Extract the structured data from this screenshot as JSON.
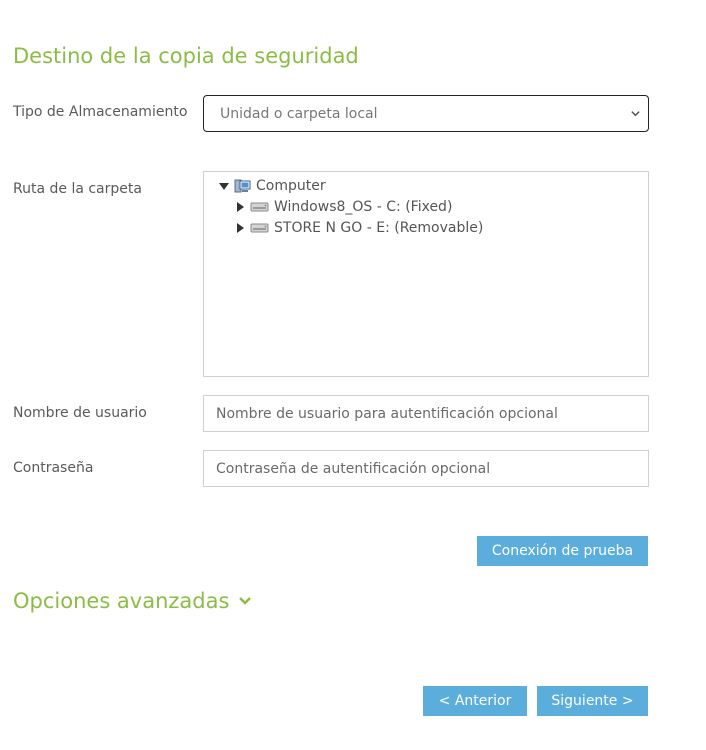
{
  "page": {
    "title": "Destino de la copia de seguridad"
  },
  "storage": {
    "label": "Tipo de Almacenamiento",
    "selected": "Unidad o carpeta local",
    "icon": "chevron-down-icon"
  },
  "folder": {
    "label": "Ruta de la carpeta",
    "tree": {
      "root": {
        "label": "Computer",
        "expanded": true,
        "icon": "computer-icon"
      },
      "children": [
        {
          "label": "Windows8_OS - C: (Fixed)",
          "expanded": false,
          "icon": "drive-icon"
        },
        {
          "label": "STORE N GO - E: (Removable)",
          "expanded": false,
          "icon": "drive-icon"
        }
      ]
    }
  },
  "username": {
    "label": "Nombre de usuario",
    "placeholder": "Nombre de usuario para autentificación opcional",
    "value": ""
  },
  "password": {
    "label": "Contraseña",
    "placeholder": "Contraseña de autentificación opcional",
    "value": ""
  },
  "buttons": {
    "test_connection": "Conexión de prueba",
    "previous": "< Anterior",
    "next": "Siguiente >"
  },
  "advanced": {
    "label": "Opciones avanzadas",
    "expanded": false
  },
  "colors": {
    "accent_green": "#8bbd45",
    "button_blue": "#5baedc"
  }
}
